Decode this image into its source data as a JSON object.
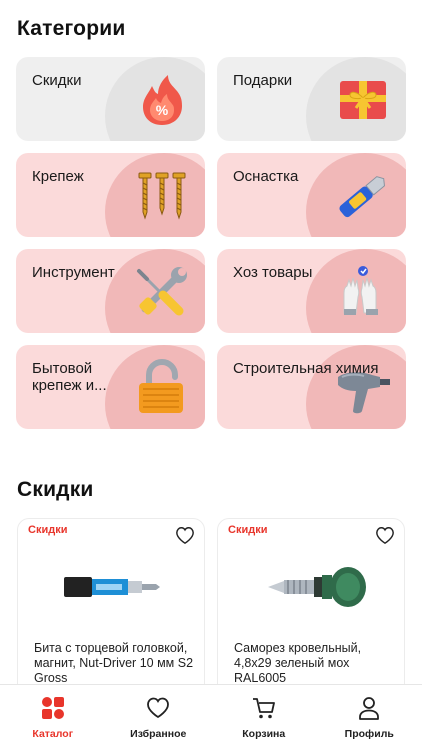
{
  "categories_section": {
    "title": "Категории"
  },
  "categories": [
    {
      "label": "Скидки",
      "icon": "discount-fire-icon"
    },
    {
      "label": "Подарки",
      "icon": "gift-icon"
    },
    {
      "label": "Крепеж",
      "icon": "screws-icon"
    },
    {
      "label": "Оснастка",
      "icon": "utility-knife-icon"
    },
    {
      "label": "Инструмент",
      "icon": "wrench-screwdriver-icon"
    },
    {
      "label": "Хоз товары",
      "icon": "gloves-icon"
    },
    {
      "label": "Бытовой крепеж и...",
      "icon": "padlock-icon"
    },
    {
      "label": "Строительная химия",
      "icon": "glue-gun-icon"
    }
  ],
  "sale_section": {
    "title": "Скидки"
  },
  "products": [
    {
      "badge": "Скидки",
      "name": "Бита с торцевой головкой, магнит, Nut-Driver 10 мм S2 Gross"
    },
    {
      "badge": "Скидки",
      "name": "Саморез кровельный, 4,8х29 зеленый мох RAL6005"
    }
  ],
  "tabbar": {
    "items": [
      {
        "label": "Каталог",
        "icon": "catalog-icon",
        "active": true
      },
      {
        "label": "Избранное",
        "icon": "heart-icon",
        "active": false
      },
      {
        "label": "Корзина",
        "icon": "cart-icon",
        "active": false
      },
      {
        "label": "Профиль",
        "icon": "profile-icon",
        "active": false
      }
    ]
  },
  "colors": {
    "accent": "#e8352b",
    "tile_pink": "#fbdada",
    "tile_gray": "#efefef"
  }
}
